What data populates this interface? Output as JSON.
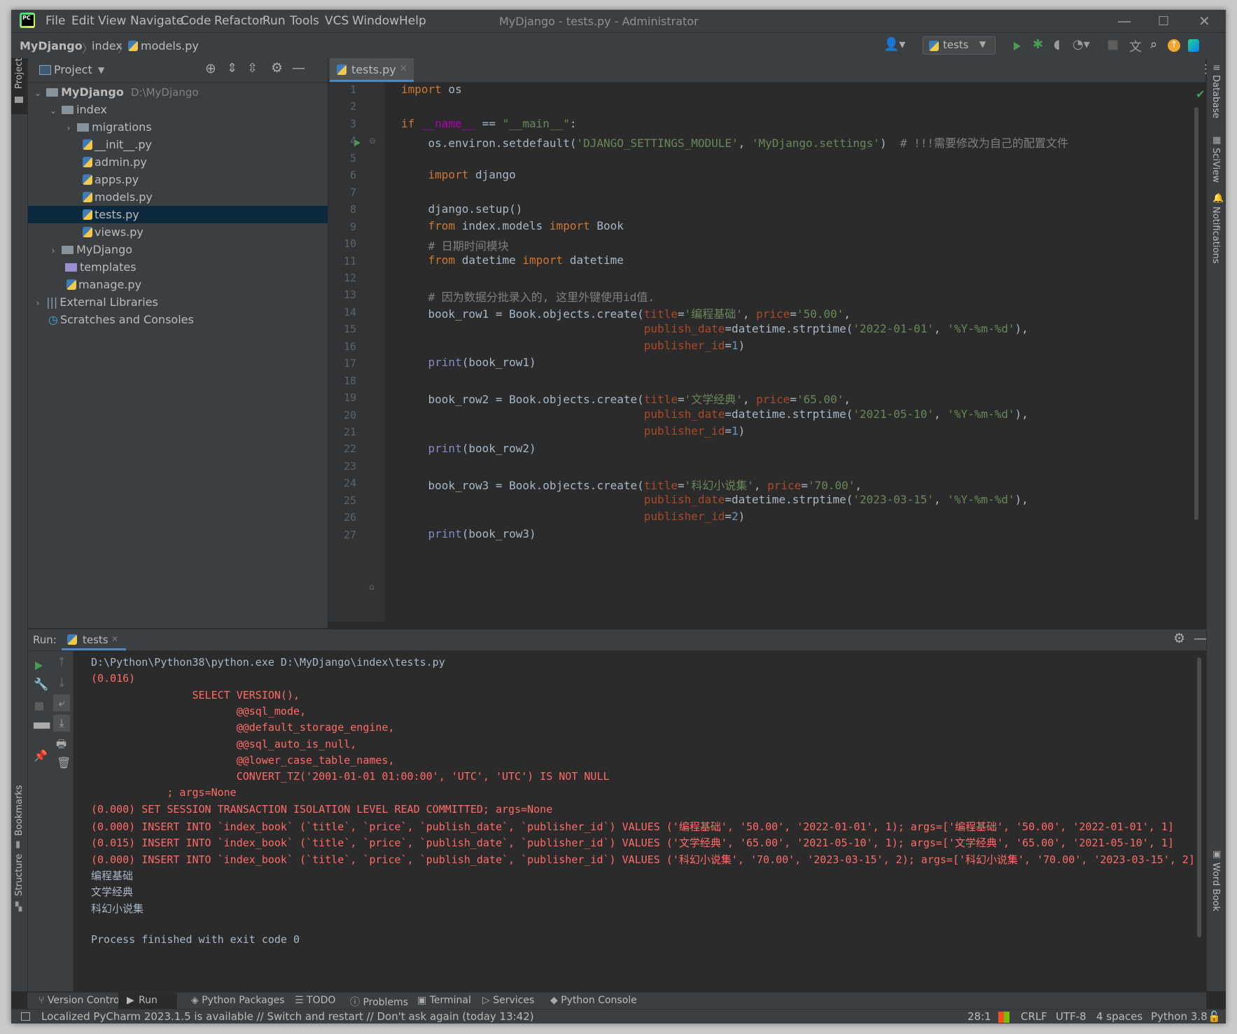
{
  "titlebar": {
    "menus": [
      "File",
      "Edit",
      "View",
      "Navigate",
      "Code",
      "Refactor",
      "Run",
      "Tools",
      "VCS",
      "Window",
      "Help"
    ],
    "window_title": "MyDjango - tests.py - Administrator"
  },
  "navbar": {
    "crumbs": [
      "MyDjango",
      "index",
      "models.py"
    ],
    "run_config": "tests"
  },
  "left_strip": {
    "project": "Project",
    "bookmarks": "Bookmarks",
    "structure": "Structure"
  },
  "right_strip": {
    "database": "Database",
    "sciview": "SciView",
    "notifications": "Notifications",
    "wordbook": "Word Book"
  },
  "project_panel": {
    "title": "Project",
    "tree": [
      {
        "label": "MyDjango",
        "extra": "D:\\MyDjango"
      },
      {
        "label": "index"
      },
      {
        "label": "migrations"
      },
      {
        "label": "__init__.py"
      },
      {
        "label": "admin.py"
      },
      {
        "label": "apps.py"
      },
      {
        "label": "models.py"
      },
      {
        "label": "tests.py"
      },
      {
        "label": "views.py"
      },
      {
        "label": "MyDjango"
      },
      {
        "label": "templates"
      },
      {
        "label": "manage.py"
      },
      {
        "label": "External Libraries"
      },
      {
        "label": "Scratches and Consoles"
      }
    ]
  },
  "editor": {
    "tab": "tests.py",
    "line_numbers": [
      "1",
      "2",
      "3",
      "4",
      "5",
      "6",
      "7",
      "8",
      "9",
      "10",
      "11",
      "12",
      "13",
      "14",
      "15",
      "16",
      "17",
      "18",
      "19",
      "20",
      "21",
      "22",
      "23",
      "24",
      "25",
      "26",
      "27"
    ]
  },
  "run_panel": {
    "label": "Run:",
    "tab": "tests",
    "output": [
      "D:\\Python\\Python38\\python.exe D:\\MyDjango\\index\\tests.py",
      "(0.016)",
      "                SELECT VERSION(),",
      "                       @@sql_mode,",
      "                       @@default_storage_engine,",
      "                       @@sql_auto_is_null,",
      "                       @@lower_case_table_names,",
      "                       CONVERT_TZ('2001-01-01 01:00:00', 'UTC', 'UTC') IS NOT NULL",
      "            ; args=None",
      "(0.000) SET SESSION TRANSACTION ISOLATION LEVEL READ COMMITTED; args=None",
      "(0.000) INSERT INTO `index_book` (`title`, `price`, `publish_date`, `publisher_id`) VALUES ('编程基础', '50.00', '2022-01-01', 1); args=['编程基础', '50.00', '2022-01-01', 1]",
      "(0.015) INSERT INTO `index_book` (`title`, `price`, `publish_date`, `publisher_id`) VALUES ('文学经典', '65.00', '2021-05-10', 1); args=['文学经典', '65.00', '2021-05-10', 1]",
      "(0.000) INSERT INTO `index_book` (`title`, `price`, `publish_date`, `publisher_id`) VALUES ('科幻小说集', '70.00', '2023-03-15', 2); args=['科幻小说集', '70.00', '2023-03-15', 2]",
      "编程基础",
      "文学经典",
      "科幻小说集",
      "",
      "Process finished with exit code 0"
    ]
  },
  "bottom_tabs": [
    "Version Control",
    "Run",
    "Python Packages",
    "TODO",
    "Problems",
    "Terminal",
    "Services",
    "Python Console"
  ],
  "status": {
    "message": "Localized PyCharm 2023.1.5 is available // Switch and restart // Don't ask again (today 13:42)",
    "position": "28:1",
    "line_sep": "CRLF",
    "encoding": "UTF-8",
    "indent": "4 spaces",
    "interpreter": "Python 3.8"
  },
  "colors": {
    "accent": "#4a88c7",
    "run_green": "#499c54",
    "error_red": "#ff6b68"
  }
}
